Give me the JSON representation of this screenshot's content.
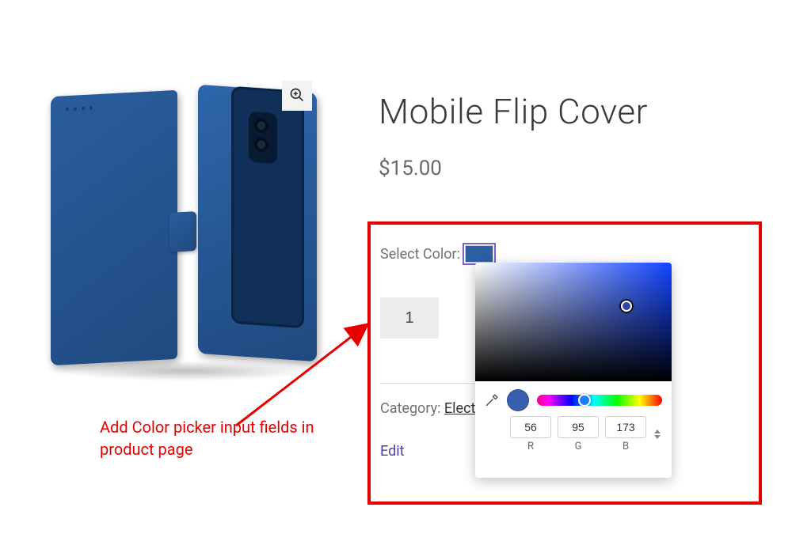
{
  "product": {
    "title": "Mobile Flip Cover",
    "price": "$15.00",
    "select_color_label": "Select Color:",
    "quantity_value": "1",
    "category_label": "Category: ",
    "category_link": "Elect",
    "edit_link": "Edit"
  },
  "picker": {
    "r_value": "56",
    "g_value": "95",
    "b_value": "173",
    "r_label": "R",
    "g_label": "G",
    "b_label": "B",
    "selected_hex": "#385fad",
    "hue_hex": "#1244ff"
  },
  "annotation": {
    "text": "Add Color picker input fields in product page"
  }
}
